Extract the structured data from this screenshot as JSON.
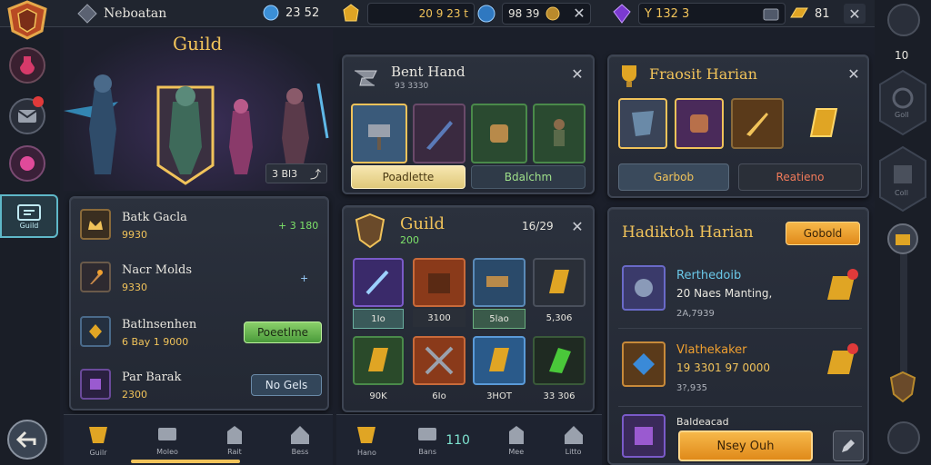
{
  "topbar": {
    "player_name": "Neboatan",
    "res1": "23 52",
    "res2": "20 9 23 t",
    "res3": "98 39",
    "res4": "Y 132 3",
    "res5": "81"
  },
  "left_rail": {
    "guild_tab_label": "Guild",
    "back_label": "Back"
  },
  "guild_hero": {
    "title": "Guild",
    "counter": "3 Bl3"
  },
  "list_panel": {
    "items": [
      {
        "title": "Batk Gacla",
        "sub": "9930",
        "right": "+ 3 180"
      },
      {
        "title": "Nacr Molds",
        "sub": "9330",
        "right": "+"
      },
      {
        "title": "Batlnsenhen",
        "sub": "6 Bay 1 9000",
        "button": "Poeetlme"
      },
      {
        "title": "Par Barak",
        "sub": "2300",
        "button": "No Gels"
      }
    ]
  },
  "panel_a": {
    "title": "Bent Hand",
    "sub": "93 3330",
    "btn_left": "Poadlette",
    "btn_right": "Bdalchm"
  },
  "panel_b": {
    "title": "Fraosit Harian",
    "btn_left": "Garbob",
    "btn_right": "Reatieno"
  },
  "panel_c": {
    "title": "Guild",
    "sub": "200",
    "counter": "16/29",
    "items": [
      {
        "label": "1Io"
      },
      {
        "label": "3100"
      },
      {
        "label": "5lao"
      },
      {
        "label": "5,306"
      },
      {
        "label": "90K"
      },
      {
        "label": "6Io"
      },
      {
        "label": "3HOT"
      },
      {
        "label": "33 306"
      }
    ]
  },
  "panel_d": {
    "title": "Hadiktoh Harian",
    "header_btn": "Gobold",
    "rows": [
      {
        "title": "Rerthedoib",
        "sub": "20 Naes Manting,",
        "extra": "2A,7939"
      },
      {
        "title": "Vlathekaker",
        "sub": "19 3301 97 0000",
        "extra": "3?,935"
      },
      {
        "title": "Baldeacad",
        "sub": ""
      }
    ],
    "bottom_btn": "Nsey Ouh"
  },
  "bottom_nav_left": {
    "items": [
      "Guilr",
      "Moleo",
      "Rait",
      "Bess"
    ]
  },
  "bottom_nav_mid": {
    "items": [
      "Hano",
      "Bans",
      "Mee",
      "Litto"
    ],
    "count": "110"
  },
  "right_rail": {
    "level": "10",
    "label1": "Goll",
    "label2": "Coll"
  },
  "colors": {
    "accent_gold": "#f1c35a",
    "accent_green": "#7ee36a",
    "accent_orange": "#f0a030",
    "panel_bg": "#262b36"
  }
}
